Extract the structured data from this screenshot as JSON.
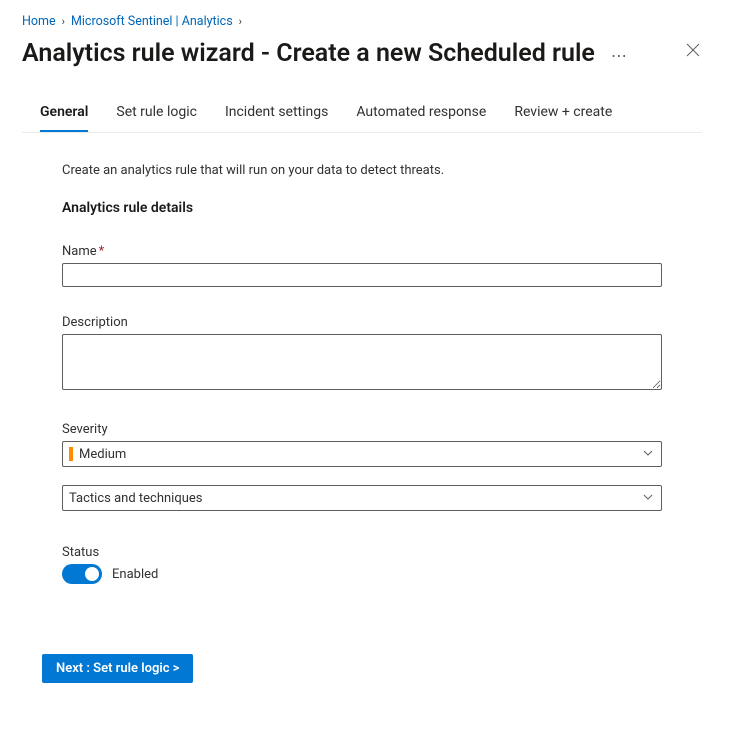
{
  "breadcrumb": {
    "items": [
      {
        "label": "Home"
      },
      {
        "label": "Microsoft Sentinel | Analytics"
      }
    ]
  },
  "header": {
    "title": "Analytics rule wizard - Create a new Scheduled rule"
  },
  "tabs": [
    {
      "label": "General",
      "active": true
    },
    {
      "label": "Set rule logic",
      "active": false
    },
    {
      "label": "Incident settings",
      "active": false
    },
    {
      "label": "Automated response",
      "active": false
    },
    {
      "label": "Review + create",
      "active": false
    }
  ],
  "content": {
    "intro": "Create an analytics rule that will run on your data to detect threats.",
    "section_title": "Analytics rule details",
    "name": {
      "label": "Name",
      "value": ""
    },
    "description": {
      "label": "Description",
      "value": ""
    },
    "severity": {
      "label": "Severity",
      "selected": "Medium",
      "color": "#ff8c00"
    },
    "tactics": {
      "placeholder": "Tactics and techniques"
    },
    "status": {
      "label": "Status",
      "state_text": "Enabled",
      "enabled": true
    }
  },
  "footer": {
    "next_label": "Next : Set rule logic >"
  }
}
